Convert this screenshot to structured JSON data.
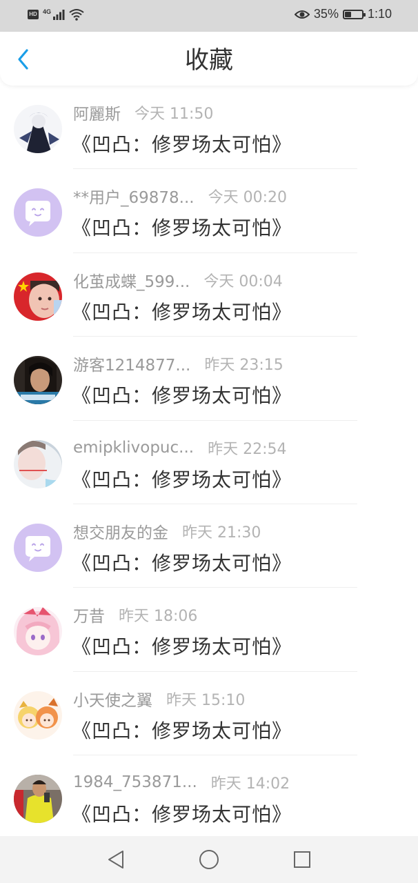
{
  "status_bar": {
    "hd": "HD",
    "network": "4G",
    "battery_percent": "35%",
    "battery_level": 0.35,
    "time": "1:10"
  },
  "header": {
    "title": "收藏",
    "back_icon": "chevron-left-icon",
    "accent_color": "#1a9ee8"
  },
  "list": [
    {
      "user": "阿麗斯",
      "time": "今天 11:50",
      "title": "《凹凸：修罗场太可怕》"
    },
    {
      "user": "**用户_69878...",
      "time": "今天 00:20",
      "title": "《凹凸：修罗场太可怕》"
    },
    {
      "user": "化茧成蝶_599...",
      "time": "今天 00:04",
      "title": "《凹凸：修罗场太可怕》"
    },
    {
      "user": "游客1214877...",
      "time": "昨天 23:15",
      "title": "《凹凸：修罗场太可怕》"
    },
    {
      "user": "emipklivopuc...",
      "time": "昨天 22:54",
      "title": "《凹凸：修罗场太可怕》"
    },
    {
      "user": "想交朋友的金",
      "time": "昨天 21:30",
      "title": "《凹凸：修罗场太可怕》"
    },
    {
      "user": "万昔",
      "time": "昨天 18:06",
      "title": "《凹凸：修罗场太可怕》"
    },
    {
      "user": "小天使之翼",
      "time": "昨天 15:10",
      "title": "《凹凸：修罗场太可怕》"
    },
    {
      "user": "1984_753871...",
      "time": "昨天 14:02",
      "title": "《凹凸：修罗场太可怕》"
    }
  ],
  "nav_bar": {
    "back_icon": "triangle-back-icon",
    "home_icon": "circle-home-icon",
    "recents_icon": "square-recents-icon"
  }
}
